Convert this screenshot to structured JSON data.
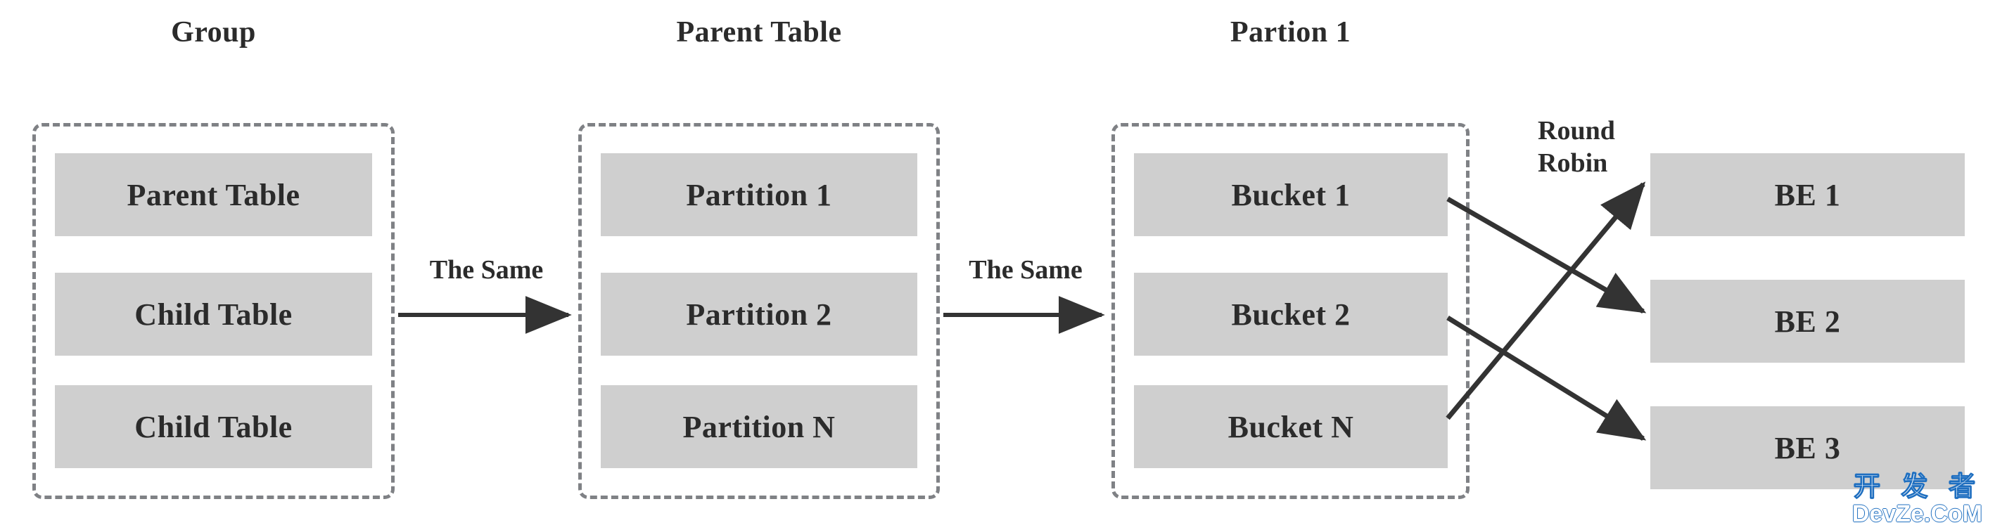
{
  "diagram": {
    "background_color": "#ffffff",
    "box_fill_color": "#cfcfcf",
    "dashed_border_color": "#7f8185",
    "text_color": "#2b2b2b",
    "arrow_color": "#333333",
    "columns": [
      {
        "id": "group",
        "title": "Group",
        "items": [
          {
            "label": "Parent Table"
          },
          {
            "label": "Child Table"
          },
          {
            "label": "Child Table"
          }
        ]
      },
      {
        "id": "parent-table",
        "title": "Parent Table",
        "items": [
          {
            "label": "Partition 1"
          },
          {
            "label": "Partition 2"
          },
          {
            "label": "Partition N"
          }
        ]
      },
      {
        "id": "partion-1",
        "title": "Partion 1",
        "items": [
          {
            "label": "Bucket 1"
          },
          {
            "label": "Bucket 2"
          },
          {
            "label": "Bucket N"
          }
        ]
      }
    ],
    "backends": {
      "items": [
        {
          "label": "BE 1"
        },
        {
          "label": "BE 2"
        },
        {
          "label": "BE 3"
        }
      ]
    },
    "edge_labels": {
      "group_to_parent": "The Same",
      "parent_to_partion": "The Same",
      "distribution_line1": "Round",
      "distribution_line2": "Robin"
    },
    "connections": [
      {
        "from": "Group",
        "to": "Parent Table",
        "label": "The Same",
        "style": "straight-arrow"
      },
      {
        "from": "Parent Table",
        "to": "Partion 1",
        "label": "The Same",
        "style": "straight-arrow"
      },
      {
        "from": "Bucket 1",
        "to": "BE 2",
        "label": "Round Robin",
        "style": "diagonal-arrow"
      },
      {
        "from": "Bucket 2",
        "to": "BE 3",
        "label": "Round Robin",
        "style": "diagonal-arrow"
      },
      {
        "from": "Bucket N",
        "to": "BE 1",
        "label": "Round Robin",
        "style": "diagonal-arrow"
      }
    ]
  },
  "watermark": {
    "chinese": "开 发 者",
    "latin": "DevZe.CoM",
    "color": "#1f6fc0"
  }
}
